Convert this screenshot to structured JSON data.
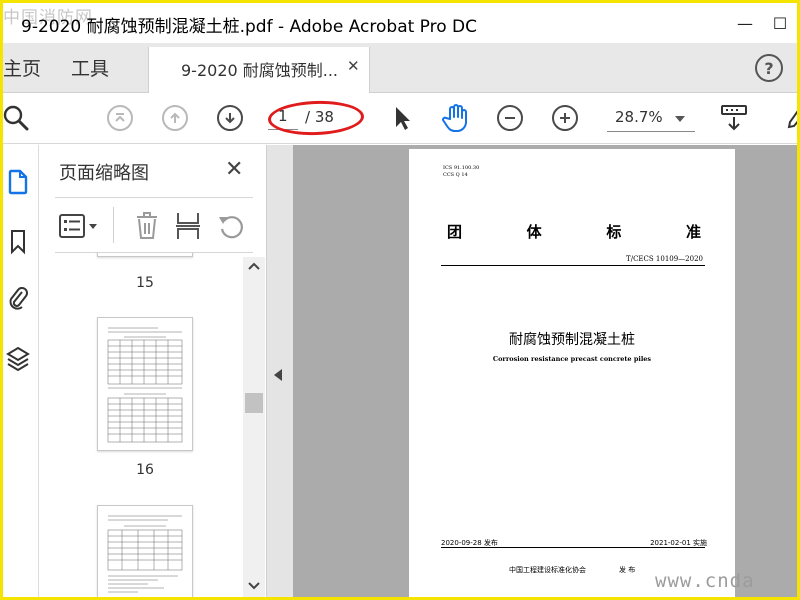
{
  "watermark_top": "中国消防网",
  "watermark_bottom": "www.cnda",
  "window": {
    "title": "9-2020 耐腐蚀预制混凝土桩.pdf - Adobe Acrobat Pro DC",
    "min_glyph": "—",
    "max_glyph": "☐"
  },
  "nav": {
    "home": "主页",
    "tools": "工具"
  },
  "tab": {
    "label": "9-2020 耐腐蚀预制...",
    "close": "✕"
  },
  "help": "?",
  "toolbar": {
    "current_page": "1",
    "total_pages": "/ 38",
    "zoom": "28.7%"
  },
  "panel": {
    "title": "页面缩略图",
    "close": "✕",
    "thumbnails": [
      {
        "page": "15"
      },
      {
        "page": "16"
      }
    ]
  },
  "document": {
    "ics": "ICS 91.100.30",
    "ccs": "CCS Q 14",
    "heading_chars": [
      "团",
      "体",
      "标",
      "准"
    ],
    "standard_no": "T/CECS 10109—2020",
    "title_cn": "耐腐蚀预制混凝土桩",
    "title_en": "Corrosion resistance precast concrete piles",
    "publish_date": "2020-09-28 发布",
    "implement_date": "2021-02-01 实施",
    "association": "中国工程建设标准化协会",
    "issue": "发 布"
  },
  "colors": {
    "border": "#f4e400",
    "highlight": "#e01b1b",
    "accent_blue": "#1473e6"
  }
}
